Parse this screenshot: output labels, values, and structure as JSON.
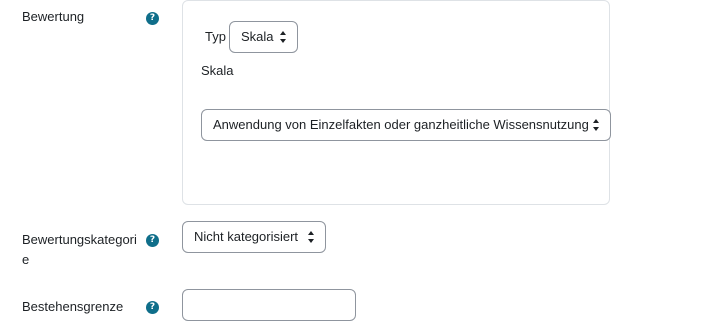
{
  "grading": {
    "label": "Bewertung",
    "help_icon": "question-circle-icon",
    "type_label": "Typ",
    "type_value": "Skala",
    "scale_label": "Skala",
    "scale_value": "Anwendung von Einzelfakten oder ganzheitliche Wissensnutzung"
  },
  "grade_category": {
    "label_line1": "Bewertungskategori",
    "label_line2": "e",
    "help_icon": "question-circle-icon",
    "value": "Nicht kategorisiert"
  },
  "pass_grade": {
    "label": "Bestehensgrenze",
    "help_icon": "question-circle-icon",
    "value": ""
  },
  "colors": {
    "help_icon": "#0f6e8a",
    "border": "#8f959e",
    "fieldset_border": "#dee2e6"
  }
}
